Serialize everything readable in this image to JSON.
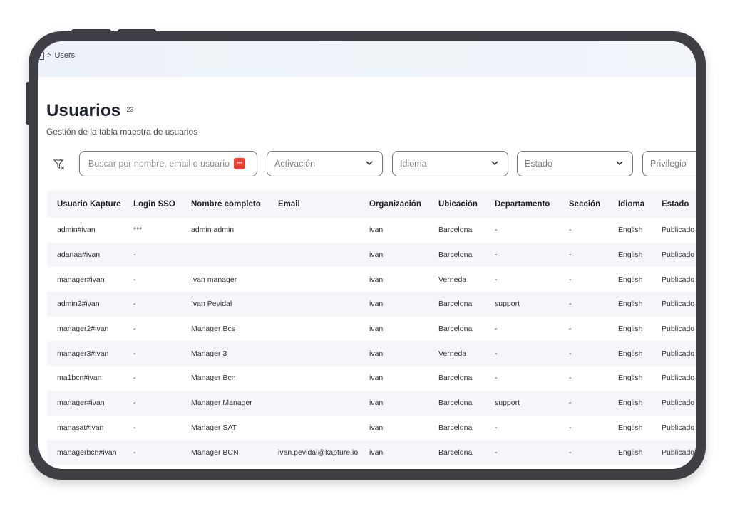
{
  "breadcrumb": {
    "separator": ">",
    "current": "Users"
  },
  "page": {
    "title": "Usuarios",
    "count": "23",
    "subtitle": "Gestión de la tabla maestra de usuarios"
  },
  "filters": {
    "search_placeholder": "Buscar por nombre, email o usuario",
    "search_badge": "•••",
    "selects": [
      "Activación",
      "Idioma",
      "Estado",
      "Privilegio"
    ]
  },
  "table": {
    "columns": [
      "Usuario Kapture",
      "Login SSO",
      "Nombre completo",
      "Email",
      "Organización",
      "Ubicación",
      "Departamento",
      "Sección",
      "Idioma",
      "Estado"
    ],
    "rows": [
      [
        "admin#ivan",
        "***",
        "admin admin",
        "",
        "ivan",
        "Barcelona",
        "-",
        "-",
        "English",
        "Publicado"
      ],
      [
        "adanaa#ivan",
        "-",
        "",
        "",
        "ivan",
        "Barcelona",
        "-",
        "-",
        "English",
        "Publicado"
      ],
      [
        "manager#ivan",
        "-",
        "Ivan manager",
        "",
        "ivan",
        "Verneda",
        "-",
        "-",
        "English",
        "Publicado"
      ],
      [
        "admin2#ivan",
        "-",
        "Ivan Pevidal",
        "",
        "ivan",
        "Barcelona",
        "support",
        "-",
        "English",
        "Publicado"
      ],
      [
        "manager2#ivan",
        "-",
        "Manager Bcs",
        "",
        "ivan",
        "Barcelona",
        "-",
        "-",
        "English",
        "Publicado"
      ],
      [
        "manager3#ivan",
        "-",
        "Manager 3",
        "",
        "ivan",
        "Verneda",
        "-",
        "-",
        "English",
        "Publicado"
      ],
      [
        "ma1bcn#ivan",
        "-",
        "Manager Bcn",
        "",
        "ivan",
        "Barcelona",
        "-",
        "-",
        "English",
        "Publicado"
      ],
      [
        "manager#ivan",
        "-",
        "Manager Manager",
        "",
        "ivan",
        "Barcelona",
        "support",
        "-",
        "English",
        "Publicado"
      ],
      [
        "manasat#ivan",
        "-",
        "Manager SAT",
        "",
        "ivan",
        "Barcelona",
        "-",
        "-",
        "English",
        "Publicado"
      ],
      [
        "managerbcn#ivan",
        "-",
        "Manager BCN",
        "ivan.pevidal@kapture.io",
        "ivan",
        "Barcelona",
        "-",
        "-",
        "English",
        "Publicado"
      ]
    ]
  }
}
